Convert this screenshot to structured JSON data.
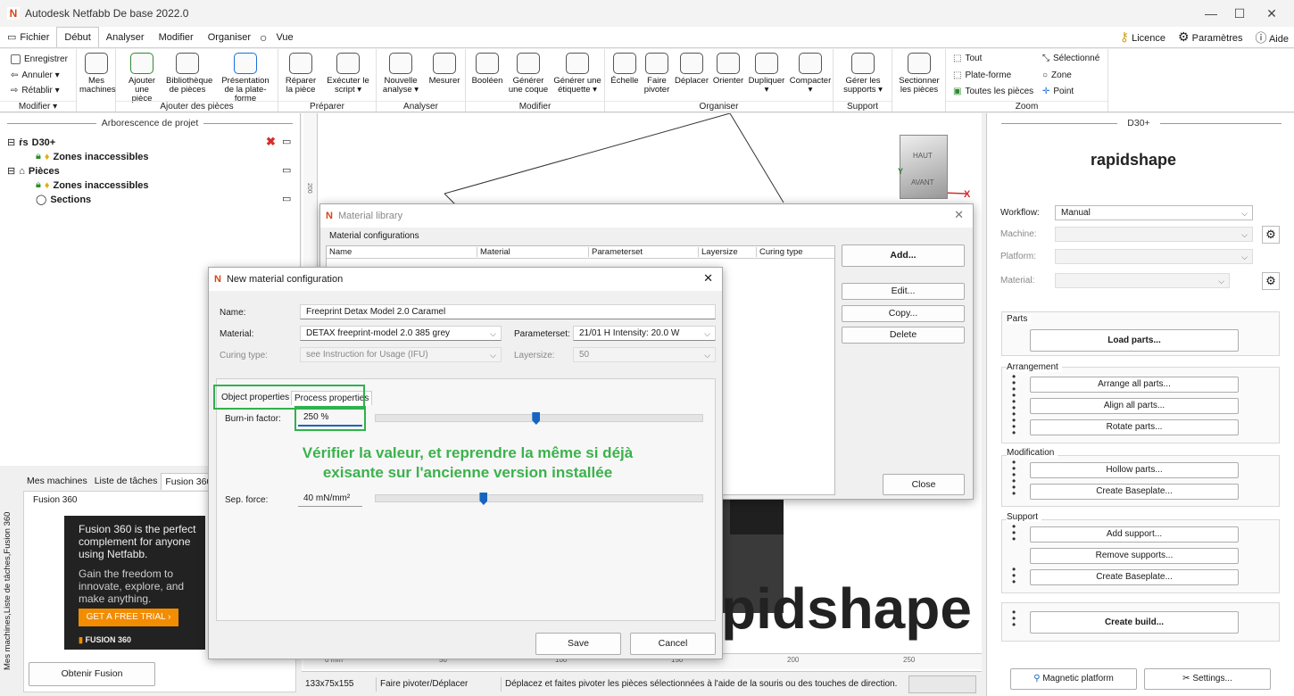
{
  "window": {
    "title": "Autodesk Netfabb De base 2022.0",
    "minimize": "—",
    "maximize": "☐",
    "close": "✕"
  },
  "menu": {
    "items": [
      "Fichier",
      "Début",
      "Analyser",
      "Modifier",
      "Organiser",
      "Vue"
    ],
    "right": {
      "licence": "Licence",
      "parametres": "Paramètres",
      "aide": "Aide"
    }
  },
  "ribbon": {
    "modifier": {
      "enregistrer": "Enregistrer",
      "annuler": "Annuler ▾",
      "retablir": "Rétablir ▾",
      "label": "Modifier ▾"
    },
    "mes_machines": "Mes machines",
    "ajouter": {
      "ajouter_piece": "Ajouter une pièce",
      "bibliotheque": "Bibliothèque de pièces",
      "presentation": "Présentation de la plate-forme",
      "label": "Ajouter des pièces"
    },
    "preparer": {
      "reparer": "Réparer la pièce",
      "executer": "Exécuter le script ▾",
      "label": "Préparer"
    },
    "analyser": {
      "nouvelle": "Nouvelle analyse ▾",
      "mesurer": "Mesurer",
      "label": "Analyser"
    },
    "modifier2": {
      "booleen": "Booléen",
      "coque": "Générer une coque",
      "etiquette": "Générer une étiquette ▾",
      "label": "Modifier"
    },
    "organiser": {
      "echelle": "Échelle",
      "pivoter": "Faire pivoter",
      "deplacer": "Déplacer",
      "orienter": "Orienter",
      "dupliquer": "Dupliquer ▾",
      "compacter": "Compacter ▾",
      "label": "Organiser"
    },
    "support": {
      "gerer": "Gérer les supports ▾",
      "label": "Support"
    },
    "sectionner": "Sectionner les pièces",
    "zoom": {
      "tout": "Tout",
      "plateforme": "Plate-forme",
      "toutes": "Toutes les pièces",
      "selectionne": "Sélectionné",
      "zone": "Zone",
      "point": "Point",
      "label": "Zoom"
    }
  },
  "tree": {
    "header": "Arborescence de projet",
    "items": [
      {
        "label": "D30+"
      },
      {
        "label": "Zones inaccessibles"
      },
      {
        "label": "Pièces"
      },
      {
        "label": "Zones inaccessibles"
      },
      {
        "label": "Sections"
      }
    ]
  },
  "bottom_left": {
    "tabs": [
      "Mes machines",
      "Liste de tâches",
      "Fusion 360"
    ],
    "vertical_tab": "Mes machines,Liste de tâches,Fusion 360",
    "panel_title": "Fusion 360",
    "ad_text1": "Fusion 360 is the perfect complement for anyone using Netfabb.",
    "ad_text2": "Gain the freedom to innovate, explore, and make anything.",
    "ad_cta": "GET A FREE TRIAL  ›",
    "ad_logo": "FUSION 360",
    "obtenir": "Obtenir Fusion"
  },
  "viewcube": {
    "top": "HAUT",
    "front": "AVANT",
    "axis_x": "X",
    "axis_y": "Y"
  },
  "viewport_brand": "pidshape",
  "ruler": {
    "ticks": [
      "0 mm",
      "50",
      "100",
      "150",
      "200",
      "250"
    ],
    "v_mark": "200"
  },
  "material_library": {
    "title": "Material library",
    "group": "Material configurations",
    "columns": [
      "Name",
      "Material",
      "Parameterset",
      "Layersize",
      "Curing type"
    ],
    "buttons": {
      "add": "Add...",
      "edit": "Edit...",
      "copy": "Copy...",
      "delete": "Delete",
      "close": "Close"
    }
  },
  "new_material": {
    "title": "New material configuration",
    "name_label": "Name:",
    "name_value": "Freeprint Detax Model 2.0 Caramel",
    "material_label": "Material:",
    "material_value": "DETAX freeprint-model 2.0 385 grey",
    "parameterset_label": "Parameterset:",
    "parameterset_value": "21/01 H Intensity: 20.0 W",
    "curing_label": "Curing type:",
    "curing_value": "see Instruction for Usage (IFU)",
    "layersize_label": "Layersize:",
    "layersize_value": "50",
    "tabs": [
      "Object properties",
      "Process properties"
    ],
    "burnin_label": "Burn-in factor:",
    "burnin_value": "250 %",
    "burnin_fraction": 0.49,
    "sep_label": "Sep. force:",
    "sep_value": "40 mN/mm²",
    "sep_fraction": 0.33,
    "save": "Save",
    "cancel": "Cancel"
  },
  "annotation": {
    "line1": "Vérifier la valeur, et reprendre la même si déjà",
    "line2": "exisante sur l'ancienne version installée"
  },
  "right_panel": {
    "header": "D30+",
    "brand": "rapidshape",
    "workflow_label": "Workflow:",
    "workflow_value": "Manual",
    "machine_label": "Machine:",
    "platform_label": "Platform:",
    "material_label": "Material:",
    "parts_header": "Parts",
    "load_parts": "Load parts...",
    "arrangement_header": "Arrangement",
    "arrange_all": "Arrange all parts...",
    "align_all": "Align all parts...",
    "rotate": "Rotate parts...",
    "modification_header": "Modification",
    "hollow": "Hollow parts...",
    "create_baseplate1": "Create Baseplate...",
    "support_header": "Support",
    "add_support": "Add support...",
    "remove_supports": "Remove supports...",
    "create_baseplate2": "Create Baseplate...",
    "create_build": "Create build...",
    "magnetic": "Magnetic platform",
    "settings": "Settings..."
  },
  "status": {
    "dims": "133x75x155",
    "mode": "Faire pivoter/Déplacer",
    "hint": "Déplacez et faites pivoter les pièces sélectionnées à l'aide de la souris ou des touches de direction."
  },
  "colors": {
    "accent": "#1565c0",
    "annotation": "#3bb24c",
    "netfabb_orange": "#d84315"
  }
}
